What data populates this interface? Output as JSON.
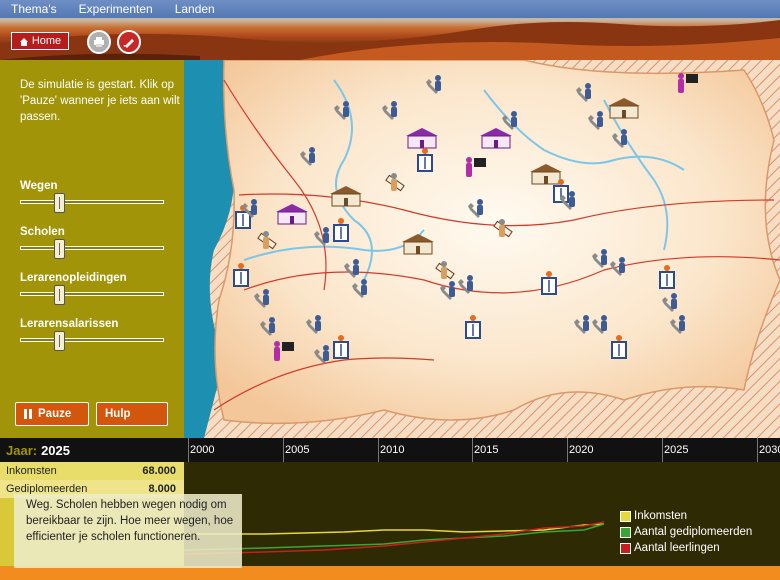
{
  "menu": [
    "Thema's",
    "Experimenten",
    "Landen"
  ],
  "home_label": "Home",
  "status_text": "De simulatie is gestart. Klik op 'Pauze' wanneer je iets aan wilt passen.",
  "sliders": [
    {
      "label": "Wegen",
      "value": 0.25
    },
    {
      "label": "Scholen",
      "value": 0.25
    },
    {
      "label": "Lerarenopleidingen",
      "value": 0.25
    },
    {
      "label": "Lerarensalarissen",
      "value": 0.25
    }
  ],
  "buttons": {
    "pause": "Pauze",
    "help": "Hulp"
  },
  "year": {
    "label": "Jaar:",
    "value": "2025"
  },
  "timeline_years": [
    "2000",
    "2005",
    "2010",
    "2015",
    "2020",
    "2025",
    "2030"
  ],
  "stats": [
    {
      "label": "Inkomsten",
      "value": "68.000"
    },
    {
      "label": "Gediplomeerden",
      "value": "8.000"
    }
  ],
  "tooltip": "Weg. Scholen hebben wegen nodig om bereikbaar te zijn. Hoe meer wegen, hoe efficienter je scholen functioneren.",
  "legend": [
    {
      "label": "Inkomsten",
      "color": "#e6d83a"
    },
    {
      "label": "Aantal gediplomeerden",
      "color": "#3aa534"
    },
    {
      "label": "Aantal leerlingen",
      "color": "#c81e1e"
    }
  ],
  "colors": {
    "panel": "#a19409",
    "accent": "#d2560b",
    "home": "#b71c1c"
  },
  "map_icons": [
    {
      "type": "wrench-icon",
      "count": 26
    },
    {
      "type": "school-icon",
      "count": 7
    },
    {
      "type": "book-icon",
      "count": 10
    },
    {
      "type": "diploma-icon",
      "count": 4
    },
    {
      "type": "teacher-icon",
      "count": 3
    }
  ]
}
